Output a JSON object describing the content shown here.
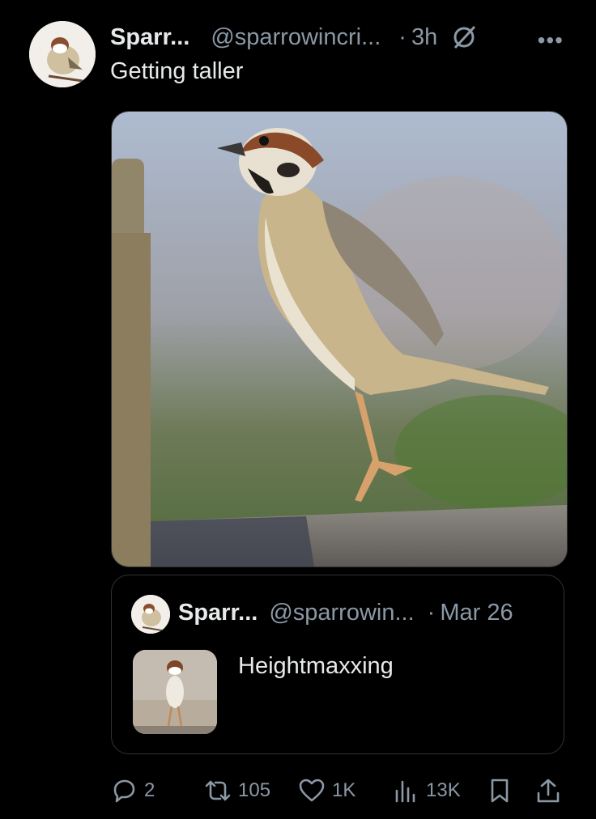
{
  "tweet": {
    "author_name": "Sparr...",
    "author_handle": "@sparrowincri...",
    "time": "3h",
    "text": "Getting taller",
    "more_icon": "more-icon",
    "grok_icon": "grok-icon"
  },
  "quote": {
    "author_name": "Sparr...",
    "author_handle": "@sparrowin...",
    "date": "Mar 26",
    "text": "Heightmaxxing"
  },
  "actions": {
    "replies": "2",
    "reposts": "105",
    "likes": "1K",
    "views": "13K"
  },
  "colors": {
    "background": "#000000",
    "primary_text": "#e7e9ea",
    "secondary_text": "#8b98a5",
    "border": "#2f3336"
  }
}
